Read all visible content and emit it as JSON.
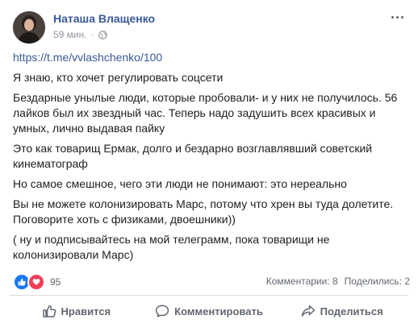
{
  "post": {
    "author": "Наташа Влащенко",
    "time": "59 мин.",
    "separator": "·",
    "privacy_icon": "globe-icon",
    "link": "https://t.me/vvlashchenko/100",
    "paragraphs": [
      "Я знаю, кто хочет регулировать соцсети",
      "Бездарные унылые люди, которые пробовали- и у них не получилось. 56 лайков был их звездный час. Теперь надо задушить всех красивых и умных, лично выдавая пайку",
      "Это как товарищ Ермак, долго и бездарно возглавлявший советский кинематограф",
      "Но самое смешное, чего эти люди не понимают: это нереально",
      "Вы не можете колонизировать Марс, потому что хрен вы туда долетите. Поговорите хоть с физиками, двоешники))",
      "( ну и подписывайтесь на мой телеграмм, пока товарищи не колонизировали Марс)"
    ]
  },
  "reactions": {
    "count": "95",
    "icons": [
      "like-icon",
      "love-icon"
    ]
  },
  "stats": {
    "comments": "Комментарии: 8",
    "shares": "Поделились: 2"
  },
  "actions": {
    "like": "Нравится",
    "comment": "Комментировать",
    "share": "Поделиться"
  },
  "colors": {
    "link": "#385898",
    "like": "#1877f2",
    "love": "#f33e58",
    "secondary_text": "#606770"
  }
}
